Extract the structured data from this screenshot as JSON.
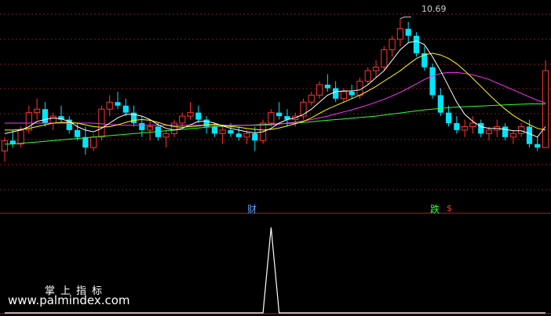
{
  "chart_data": [
    {
      "type": "candlestick",
      "panel": "price",
      "high_annotation": "10.69",
      "colors": {
        "up": "#ff3333",
        "down": "#00e5ff",
        "ma5": "#ffffff",
        "ma10": "#ffff00",
        "ma20": "#ff33ff",
        "ma60": "#33ff33",
        "grid": "#7a1f1f"
      },
      "candles": [
        [
          6.9,
          7.3,
          6.6,
          7.2
        ],
        [
          7.2,
          7.5,
          7.0,
          7.1
        ],
        [
          7.1,
          7.6,
          7.0,
          7.5
        ],
        [
          7.5,
          8.2,
          7.4,
          8.0
        ],
        [
          8.0,
          8.4,
          7.8,
          8.1
        ],
        [
          8.1,
          8.3,
          7.6,
          7.7
        ],
        [
          7.7,
          8.0,
          7.5,
          7.9
        ],
        [
          7.9,
          8.2,
          7.7,
          7.8
        ],
        [
          7.8,
          7.9,
          7.4,
          7.5
        ],
        [
          7.5,
          7.7,
          7.2,
          7.3
        ],
        [
          7.3,
          7.6,
          6.8,
          7.0
        ],
        [
          7.0,
          7.4,
          6.9,
          7.3
        ],
        [
          7.3,
          8.2,
          7.2,
          8.1
        ],
        [
          8.1,
          8.5,
          7.9,
          8.3
        ],
        [
          8.3,
          8.6,
          8.1,
          8.2
        ],
        [
          8.2,
          8.4,
          7.9,
          8.0
        ],
        [
          8.0,
          8.2,
          7.6,
          7.7
        ],
        [
          7.7,
          7.9,
          7.3,
          7.5
        ],
        [
          7.5,
          7.8,
          7.2,
          7.6
        ],
        [
          7.6,
          7.7,
          7.2,
          7.3
        ],
        [
          7.3,
          7.5,
          7.0,
          7.4
        ],
        [
          7.4,
          7.8,
          7.3,
          7.7
        ],
        [
          7.7,
          8.0,
          7.6,
          7.9
        ],
        [
          7.9,
          8.3,
          7.8,
          8.0
        ],
        [
          8.0,
          8.2,
          7.7,
          7.8
        ],
        [
          7.8,
          7.9,
          7.4,
          7.6
        ],
        [
          7.6,
          7.7,
          7.3,
          7.4
        ],
        [
          7.4,
          7.6,
          7.1,
          7.5
        ],
        [
          7.5,
          7.7,
          7.3,
          7.4
        ],
        [
          7.4,
          7.6,
          7.2,
          7.3
        ],
        [
          7.3,
          7.5,
          7.1,
          7.4
        ],
        [
          7.4,
          7.6,
          6.9,
          7.2
        ],
        [
          7.2,
          7.8,
          7.1,
          7.7
        ],
        [
          7.7,
          8.1,
          7.6,
          8.0
        ],
        [
          8.0,
          8.3,
          7.8,
          7.9
        ],
        [
          7.9,
          8.1,
          7.6,
          7.8
        ],
        [
          7.8,
          8.0,
          7.6,
          7.9
        ],
        [
          7.9,
          8.4,
          7.8,
          8.3
        ],
        [
          8.3,
          8.6,
          8.2,
          8.5
        ],
        [
          8.5,
          8.9,
          8.4,
          8.8
        ],
        [
          8.8,
          9.1,
          8.6,
          8.7
        ],
        [
          8.7,
          8.9,
          8.3,
          8.4
        ],
        [
          8.4,
          8.7,
          8.3,
          8.6
        ],
        [
          8.6,
          8.8,
          8.4,
          8.5
        ],
        [
          8.5,
          9.0,
          8.4,
          8.9
        ],
        [
          8.9,
          9.3,
          8.8,
          9.2
        ],
        [
          9.2,
          9.5,
          9.0,
          9.3
        ],
        [
          9.3,
          9.9,
          9.2,
          9.8
        ],
        [
          9.8,
          10.2,
          9.6,
          10.1
        ],
        [
          10.1,
          10.69,
          9.9,
          10.4
        ],
        [
          10.4,
          10.6,
          10.0,
          10.2
        ],
        [
          10.2,
          10.3,
          9.6,
          9.7
        ],
        [
          9.7,
          9.9,
          9.2,
          9.3
        ],
        [
          9.3,
          9.4,
          8.4,
          8.5
        ],
        [
          8.5,
          8.7,
          7.9,
          8.0
        ],
        [
          8.0,
          8.2,
          7.6,
          7.7
        ],
        [
          7.7,
          7.9,
          7.4,
          7.5
        ],
        [
          7.5,
          7.8,
          7.3,
          7.6
        ],
        [
          7.6,
          7.9,
          7.4,
          7.7
        ],
        [
          7.7,
          7.8,
          7.3,
          7.4
        ],
        [
          7.4,
          7.6,
          7.2,
          7.5
        ],
        [
          7.5,
          7.8,
          7.3,
          7.6
        ],
        [
          7.6,
          7.7,
          7.2,
          7.3
        ],
        [
          7.3,
          7.5,
          7.1,
          7.4
        ],
        [
          7.4,
          7.7,
          7.3,
          7.6
        ],
        [
          7.6,
          7.8,
          7.0,
          7.1
        ],
        [
          7.1,
          7.3,
          6.9,
          7.0
        ],
        [
          7.0,
          9.5,
          7.0,
          9.2
        ]
      ],
      "ma5": [
        7.4,
        7.45,
        7.5,
        7.6,
        7.75,
        7.8,
        7.85,
        7.82,
        7.75,
        7.6,
        7.5,
        7.45,
        7.55,
        7.7,
        7.85,
        7.95,
        7.95,
        7.9,
        7.8,
        7.65,
        7.55,
        7.5,
        7.55,
        7.65,
        7.75,
        7.75,
        7.7,
        7.62,
        7.55,
        7.5,
        7.45,
        7.42,
        7.45,
        7.55,
        7.7,
        7.8,
        7.85,
        7.95,
        8.1,
        8.3,
        8.5,
        8.6,
        8.62,
        8.62,
        8.65,
        8.8,
        9.0,
        9.2,
        9.5,
        9.8,
        10.0,
        10.05,
        9.95,
        9.6,
        9.2,
        8.75,
        8.3,
        7.95,
        7.75,
        7.6,
        7.55,
        7.55,
        7.52,
        7.48,
        7.48,
        7.4,
        7.3,
        7.6
      ],
      "ma10": [
        7.5,
        7.5,
        7.52,
        7.55,
        7.6,
        7.65,
        7.7,
        7.72,
        7.72,
        7.7,
        7.65,
        7.6,
        7.58,
        7.6,
        7.65,
        7.72,
        7.78,
        7.8,
        7.78,
        7.72,
        7.65,
        7.6,
        7.58,
        7.6,
        7.62,
        7.65,
        7.66,
        7.64,
        7.6,
        7.58,
        7.55,
        7.52,
        7.5,
        7.52,
        7.56,
        7.62,
        7.68,
        7.75,
        7.85,
        7.98,
        8.1,
        8.2,
        8.3,
        8.4,
        8.5,
        8.62,
        8.75,
        8.9,
        9.05,
        9.2,
        9.38,
        9.55,
        9.65,
        9.7,
        9.65,
        9.55,
        9.4,
        9.2,
        8.98,
        8.75,
        8.52,
        8.3,
        8.1,
        7.92,
        7.78,
        7.66,
        7.55,
        7.5
      ],
      "ma20": [
        7.7,
        7.7,
        7.7,
        7.7,
        7.7,
        7.7,
        7.7,
        7.7,
        7.7,
        7.7,
        7.7,
        7.7,
        7.68,
        7.66,
        7.65,
        7.64,
        7.64,
        7.64,
        7.64,
        7.64,
        7.64,
        7.64,
        7.64,
        7.64,
        7.64,
        7.64,
        7.64,
        7.64,
        7.64,
        7.64,
        7.64,
        7.64,
        7.64,
        7.65,
        7.67,
        7.7,
        7.73,
        7.76,
        7.8,
        7.85,
        7.9,
        7.96,
        8.02,
        8.08,
        8.15,
        8.22,
        8.3,
        8.38,
        8.48,
        8.58,
        8.7,
        8.82,
        8.95,
        9.05,
        9.12,
        9.15,
        9.15,
        9.12,
        9.08,
        9.02,
        8.95,
        8.85,
        8.75,
        8.65,
        8.55,
        8.45,
        8.35,
        8.28
      ],
      "ma60": [
        7.1,
        7.1,
        7.12,
        7.14,
        7.16,
        7.18,
        7.2,
        7.22,
        7.24,
        7.26,
        7.28,
        7.3,
        7.32,
        7.34,
        7.36,
        7.38,
        7.4,
        7.42,
        7.44,
        7.46,
        7.48,
        7.5,
        7.52,
        7.54,
        7.56,
        7.58,
        7.6,
        7.61,
        7.62,
        7.63,
        7.64,
        7.65,
        7.66,
        7.67,
        7.68,
        7.69,
        7.7,
        7.72,
        7.74,
        7.76,
        7.78,
        7.8,
        7.82,
        7.84,
        7.86,
        7.88,
        7.9,
        7.93,
        7.96,
        7.99,
        8.02,
        8.05,
        8.08,
        8.1,
        8.12,
        8.14,
        8.16,
        8.17,
        8.18,
        8.19,
        8.2,
        8.21,
        8.22,
        8.23,
        8.24,
        8.25,
        8.25,
        8.25
      ],
      "y_range": [
        5.5,
        11.0
      ]
    },
    {
      "type": "line",
      "panel": "indicator",
      "values": [
        0,
        0,
        0,
        0,
        0,
        0,
        0,
        0,
        0,
        0,
        0,
        0,
        0,
        0,
        0,
        0,
        0,
        0,
        0,
        0,
        0,
        0,
        0,
        0,
        0,
        0,
        0,
        0,
        0,
        0,
        0,
        0,
        0,
        1,
        0,
        0,
        0,
        0,
        0,
        0,
        0,
        0,
        0,
        0,
        0,
        0,
        0,
        0,
        0,
        0,
        0,
        0,
        0,
        0,
        0,
        0,
        0,
        0,
        0,
        0,
        0,
        0,
        0,
        0,
        0,
        0,
        0,
        0
      ],
      "markers": [
        {
          "text": "财",
          "color": "#5aa0ff"
        },
        {
          "text": "跌",
          "color": "#33ff33"
        },
        {
          "text": "$",
          "color": "#ff3333"
        }
      ],
      "y_range": [
        0,
        1
      ]
    }
  ],
  "watermark": {
    "title": "掌上指标",
    "url": "www.palmindex.com"
  }
}
